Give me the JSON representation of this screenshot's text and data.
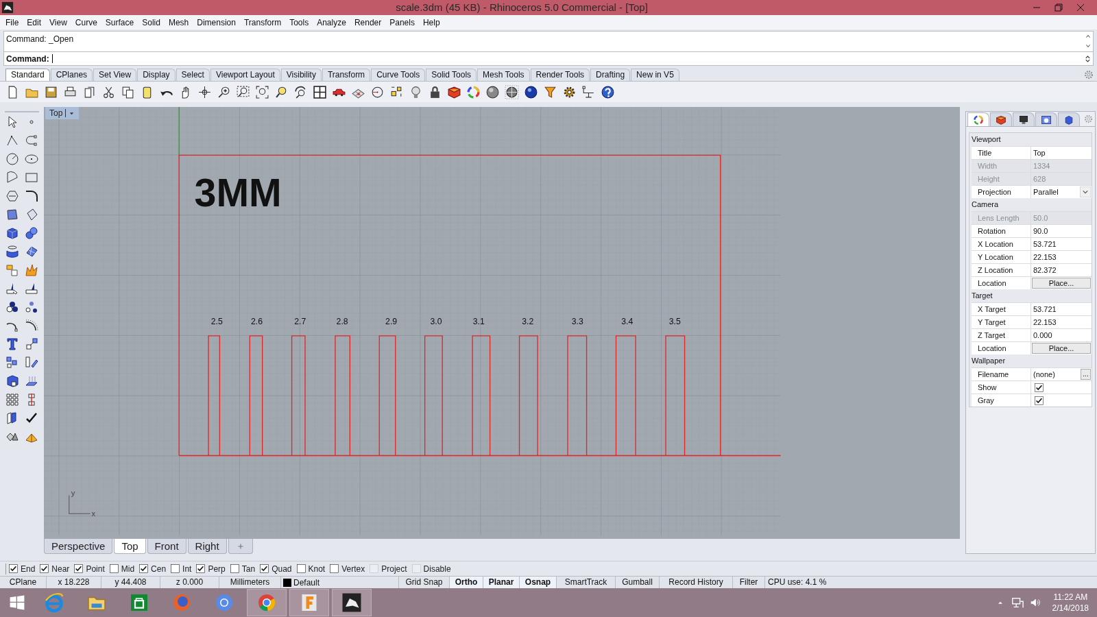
{
  "window": {
    "title": "scale.3dm (45 KB) - Rhinoceros 5.0 Commercial - [Top]"
  },
  "menu": [
    "File",
    "Edit",
    "View",
    "Curve",
    "Surface",
    "Solid",
    "Mesh",
    "Dimension",
    "Transform",
    "Tools",
    "Analyze",
    "Render",
    "Panels",
    "Help"
  ],
  "command": {
    "history": "Command: _Open",
    "prompt": "Command:"
  },
  "toolbar_tabs": [
    {
      "label": "Standard",
      "selected": true
    },
    {
      "label": "CPlanes",
      "selected": false
    },
    {
      "label": "Set View",
      "selected": false
    },
    {
      "label": "Display",
      "selected": false
    },
    {
      "label": "Select",
      "selected": false
    },
    {
      "label": "Viewport Layout",
      "selected": false
    },
    {
      "label": "Visibility",
      "selected": false
    },
    {
      "label": "Transform",
      "selected": false
    },
    {
      "label": "Curve Tools",
      "selected": false
    },
    {
      "label": "Solid Tools",
      "selected": false
    },
    {
      "label": "Mesh Tools",
      "selected": false
    },
    {
      "label": "Render Tools",
      "selected": false
    },
    {
      "label": "Drafting",
      "selected": false
    },
    {
      "label": "New in V5",
      "selected": false
    }
  ],
  "viewport": {
    "title": "Top",
    "drawing_title": "3MM",
    "slot_labels": [
      "2.5",
      "2.6",
      "2.7",
      "2.8",
      "2.9",
      "3.0",
      "3.1",
      "3.2",
      "3.3",
      "3.4",
      "3.5"
    ],
    "axis_labels": {
      "y": "y",
      "x": "x"
    },
    "tabs": [
      {
        "label": "Perspective",
        "selected": false
      },
      {
        "label": "Top",
        "selected": true
      },
      {
        "label": "Front",
        "selected": false
      },
      {
        "label": "Right",
        "selected": false
      }
    ]
  },
  "panel": {
    "tabs": [
      {
        "selected": true
      },
      {
        "selected": false
      },
      {
        "selected": false
      },
      {
        "selected": false
      },
      {
        "selected": false
      }
    ],
    "sections": [
      {
        "title": "Viewport",
        "rows": [
          {
            "label": "Title",
            "value": "Top",
            "kind": "text",
            "disabled": false
          },
          {
            "label": "Width",
            "value": "1334",
            "kind": "text",
            "disabled": true
          },
          {
            "label": "Height",
            "value": "628",
            "kind": "text",
            "disabled": true
          },
          {
            "label": "Projection",
            "value": "Parallel",
            "kind": "dropdown",
            "disabled": false
          }
        ]
      },
      {
        "title": "Camera",
        "rows": [
          {
            "label": "Lens Length",
            "value": "50.0",
            "kind": "text",
            "disabled": true
          },
          {
            "label": "Rotation",
            "value": "90.0",
            "kind": "text",
            "disabled": false
          },
          {
            "label": "X Location",
            "value": "53.721",
            "kind": "text",
            "disabled": false
          },
          {
            "label": "Y Location",
            "value": "22.153",
            "kind": "text",
            "disabled": false
          },
          {
            "label": "Z Location",
            "value": "82.372",
            "kind": "text",
            "disabled": false
          },
          {
            "label": "Location",
            "value": "Place...",
            "kind": "button",
            "disabled": false
          }
        ]
      },
      {
        "title": "Target",
        "rows": [
          {
            "label": "X Target",
            "value": "53.721",
            "kind": "text",
            "disabled": false
          },
          {
            "label": "Y Target",
            "value": "22.153",
            "kind": "text",
            "disabled": false
          },
          {
            "label": "Z Target",
            "value": "0.000",
            "kind": "text",
            "disabled": false
          },
          {
            "label": "Location",
            "value": "Place...",
            "kind": "button",
            "disabled": false
          }
        ]
      },
      {
        "title": "Wallpaper",
        "rows": [
          {
            "label": "Filename",
            "value": "(none)",
            "kind": "file",
            "button": "...",
            "disabled": false
          },
          {
            "label": "Show",
            "kind": "checkbox",
            "checked": true,
            "disabled": false
          },
          {
            "label": "Gray",
            "kind": "checkbox",
            "checked": true,
            "disabled": false
          }
        ]
      }
    ]
  },
  "osnap": [
    {
      "label": "End",
      "kind": "checkbox",
      "checked": true
    },
    {
      "label": "Near",
      "kind": "checkbox",
      "checked": true
    },
    {
      "label": "Point",
      "kind": "checkbox",
      "checked": true
    },
    {
      "label": "Mid",
      "kind": "checkbox",
      "checked": false
    },
    {
      "label": "Cen",
      "kind": "checkbox",
      "checked": true
    },
    {
      "label": "Int",
      "kind": "checkbox",
      "checked": false
    },
    {
      "label": "Perp",
      "kind": "checkbox",
      "checked": true
    },
    {
      "label": "Tan",
      "kind": "checkbox",
      "checked": false
    },
    {
      "label": "Quad",
      "kind": "checkbox",
      "checked": true
    },
    {
      "label": "Knot",
      "kind": "checkbox",
      "checked": false
    },
    {
      "label": "Vertex",
      "kind": "checkbox",
      "checked": false
    },
    {
      "label": "Project",
      "kind": "toggle",
      "checked": false
    },
    {
      "label": "Disable",
      "kind": "toggle",
      "checked": false
    }
  ],
  "status_bar": {
    "cplane": "CPlane",
    "x": "x 18.228",
    "y": "y 44.408",
    "z": "z 0.000",
    "units": "Millimeters",
    "layer": {
      "name": "Default",
      "color": "#000000"
    },
    "toggles": [
      {
        "label": "Grid Snap",
        "on": false
      },
      {
        "label": "Ortho",
        "on": true
      },
      {
        "label": "Planar",
        "on": true
      },
      {
        "label": "Osnap",
        "on": true
      },
      {
        "label": "SmartTrack",
        "on": false
      },
      {
        "label": "Gumball",
        "on": false
      },
      {
        "label": "Record History",
        "on": false
      },
      {
        "label": "Filter",
        "on": false
      }
    ],
    "cpu": "CPU use: 4.1 %"
  },
  "taskbar": {
    "apps": [
      {
        "running": false
      },
      {
        "running": false
      },
      {
        "running": false
      },
      {
        "running": false
      },
      {
        "running": false
      },
      {
        "running": true
      },
      {
        "running": true
      },
      {
        "running": true
      }
    ],
    "clock": {
      "time": "11:22 AM",
      "date": "2/14/2018"
    }
  }
}
